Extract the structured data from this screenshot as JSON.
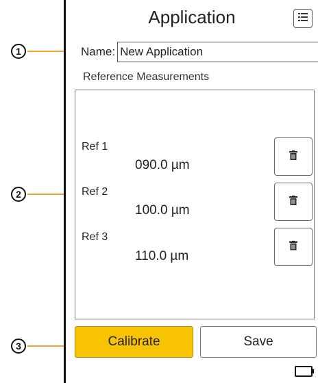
{
  "callouts": [
    "1",
    "2",
    "3"
  ],
  "header": {
    "title": "Application",
    "menu_icon": "list-menu-icon"
  },
  "name_field": {
    "label": "Name:",
    "value": "New Application"
  },
  "reference": {
    "section_label": "Reference Measurements",
    "items": [
      {
        "label": "Ref 1",
        "value": "090.0 µm"
      },
      {
        "label": "Ref 2",
        "value": "100.0 µm"
      },
      {
        "label": "Ref 3",
        "value": "110.0 µm"
      }
    ]
  },
  "actions": {
    "calibrate_label": "Calibrate",
    "save_label": "Save"
  },
  "colors": {
    "accent": "#f8c300",
    "callout_line": "#f0a030"
  },
  "status": {
    "battery_icon": "battery-icon"
  }
}
